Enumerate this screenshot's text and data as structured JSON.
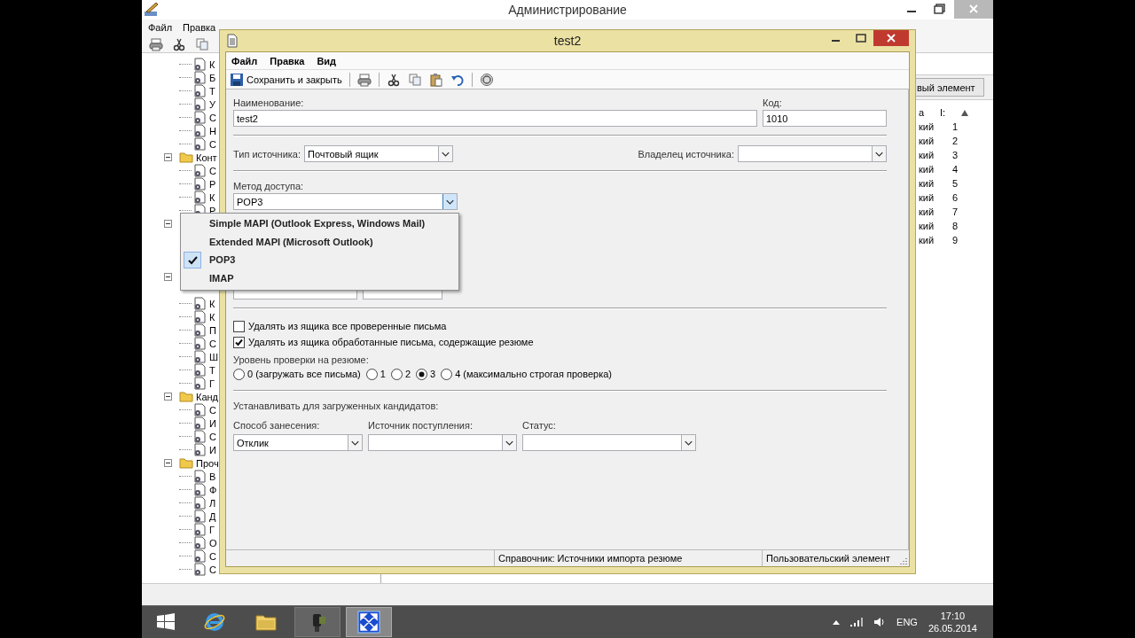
{
  "background_window": {
    "title": "Администрирование",
    "menu": [
      "Файл",
      "Правка"
    ],
    "tree": [
      {
        "label": "К"
      },
      {
        "label": "Б"
      },
      {
        "label": "Т"
      },
      {
        "label": "У"
      },
      {
        "label": "С"
      },
      {
        "label": "Н"
      },
      {
        "label": "С"
      },
      {
        "label": "Конт",
        "expanded": true,
        "children": [
          {
            "label": "С"
          },
          {
            "label": "Р"
          },
          {
            "label": "К"
          },
          {
            "label": "Р"
          }
        ]
      },
      {
        "expanded": true
      },
      {
        "expanded": true,
        "children": [
          {
            "label": "К"
          },
          {
            "label": "К"
          },
          {
            "label": "П"
          },
          {
            "label": "С"
          },
          {
            "label": "Ш"
          },
          {
            "label": "Т"
          },
          {
            "label": "Г"
          }
        ]
      },
      {
        "label": "Канд",
        "expanded": true,
        "children": [
          {
            "label": "С"
          },
          {
            "label": "И"
          },
          {
            "label": "С"
          },
          {
            "label": "И"
          }
        ]
      },
      {
        "label": "Проч",
        "expanded": true,
        "children": [
          {
            "label": "В"
          },
          {
            "label": "Ф"
          },
          {
            "label": "Л"
          },
          {
            "label": "Д"
          },
          {
            "label": "Г"
          },
          {
            "label": "О"
          },
          {
            "label": "С"
          },
          {
            "label": "С"
          }
        ]
      }
    ],
    "new_button": "вый элемент",
    "list": {
      "columns": [
        "а",
        "І:"
      ],
      "rows": [
        {
          "cells": [
            "кий",
            "1"
          ]
        },
        {
          "cells": [
            "кий",
            "2"
          ]
        },
        {
          "cells": [
            "кий",
            "3"
          ]
        },
        {
          "cells": [
            "кий",
            "4"
          ]
        },
        {
          "cells": [
            "кий",
            "5"
          ]
        },
        {
          "cells": [
            "кий",
            "6"
          ]
        },
        {
          "cells": [
            "кий",
            "7"
          ]
        },
        {
          "cells": [
            "кий",
            "8"
          ]
        },
        {
          "cells": [
            "кий",
            "9"
          ]
        }
      ]
    }
  },
  "dialog": {
    "title": "test2",
    "menu": [
      "Файл",
      "Правка",
      "Вид"
    ],
    "save_label": "Сохранить и закрыть",
    "name_field": {
      "label": "Наименование:",
      "value": "test2"
    },
    "code_field": {
      "label": "Код:",
      "value": "1010"
    },
    "source_type": {
      "label": "Тип источника:",
      "value": "Почтовый ящик"
    },
    "source_owner": {
      "label": "Владелец источника:"
    },
    "access_method": {
      "label": "Метод доступа:",
      "value": "POP3",
      "expanded": true,
      "options": [
        {
          "label": "Simple MAPI (Outlook Express, Windows Mail)",
          "selected": false
        },
        {
          "label": "Extended MAPI (Microsoft Outlook)",
          "selected": false
        },
        {
          "label": "POP3",
          "selected": true
        },
        {
          "label": "IMAP",
          "selected": false
        }
      ]
    },
    "extra_fields": [
      {
        "kind": "text"
      },
      {
        "kind": "text"
      }
    ],
    "checkboxes": [
      {
        "label": "Удалять из ящика все проверенные письма",
        "checked": false
      },
      {
        "label": "Удалять из ящика обработанные письма, содержащие резюме",
        "checked": true
      }
    ],
    "check_level": {
      "label": "Уровень проверки на резюме:",
      "options": [
        {
          "label": "0 (загружать все письма)",
          "selected": false
        },
        {
          "label": "1",
          "selected": false
        },
        {
          "label": "2",
          "selected": false
        },
        {
          "label": "3",
          "selected": true
        },
        {
          "label": "4 (максимально строгая проверка)",
          "selected": false
        }
      ]
    },
    "defaults": {
      "label": "Устанавливать для загруженных кандидатов:",
      "fields": [
        {
          "label": "Способ занесения:",
          "value": "Отклик"
        },
        {
          "label": "Источник поступления:"
        },
        {
          "label": "Статус:"
        }
      ]
    },
    "status_bar": [
      "Справочник: Источники импорта резюме",
      "Пользовательский элемент"
    ]
  },
  "taskbar": {
    "apps": [
      {
        "kind": "browser",
        "running": false,
        "selected": false
      },
      {
        "kind": "files",
        "running": false,
        "selected": false
      },
      {
        "kind": "camera",
        "running": true,
        "selected": false
      },
      {
        "kind": "remote",
        "running": true,
        "selected": true
      }
    ],
    "language": "ENG",
    "time": "17:10",
    "date": "26.05.2014"
  }
}
